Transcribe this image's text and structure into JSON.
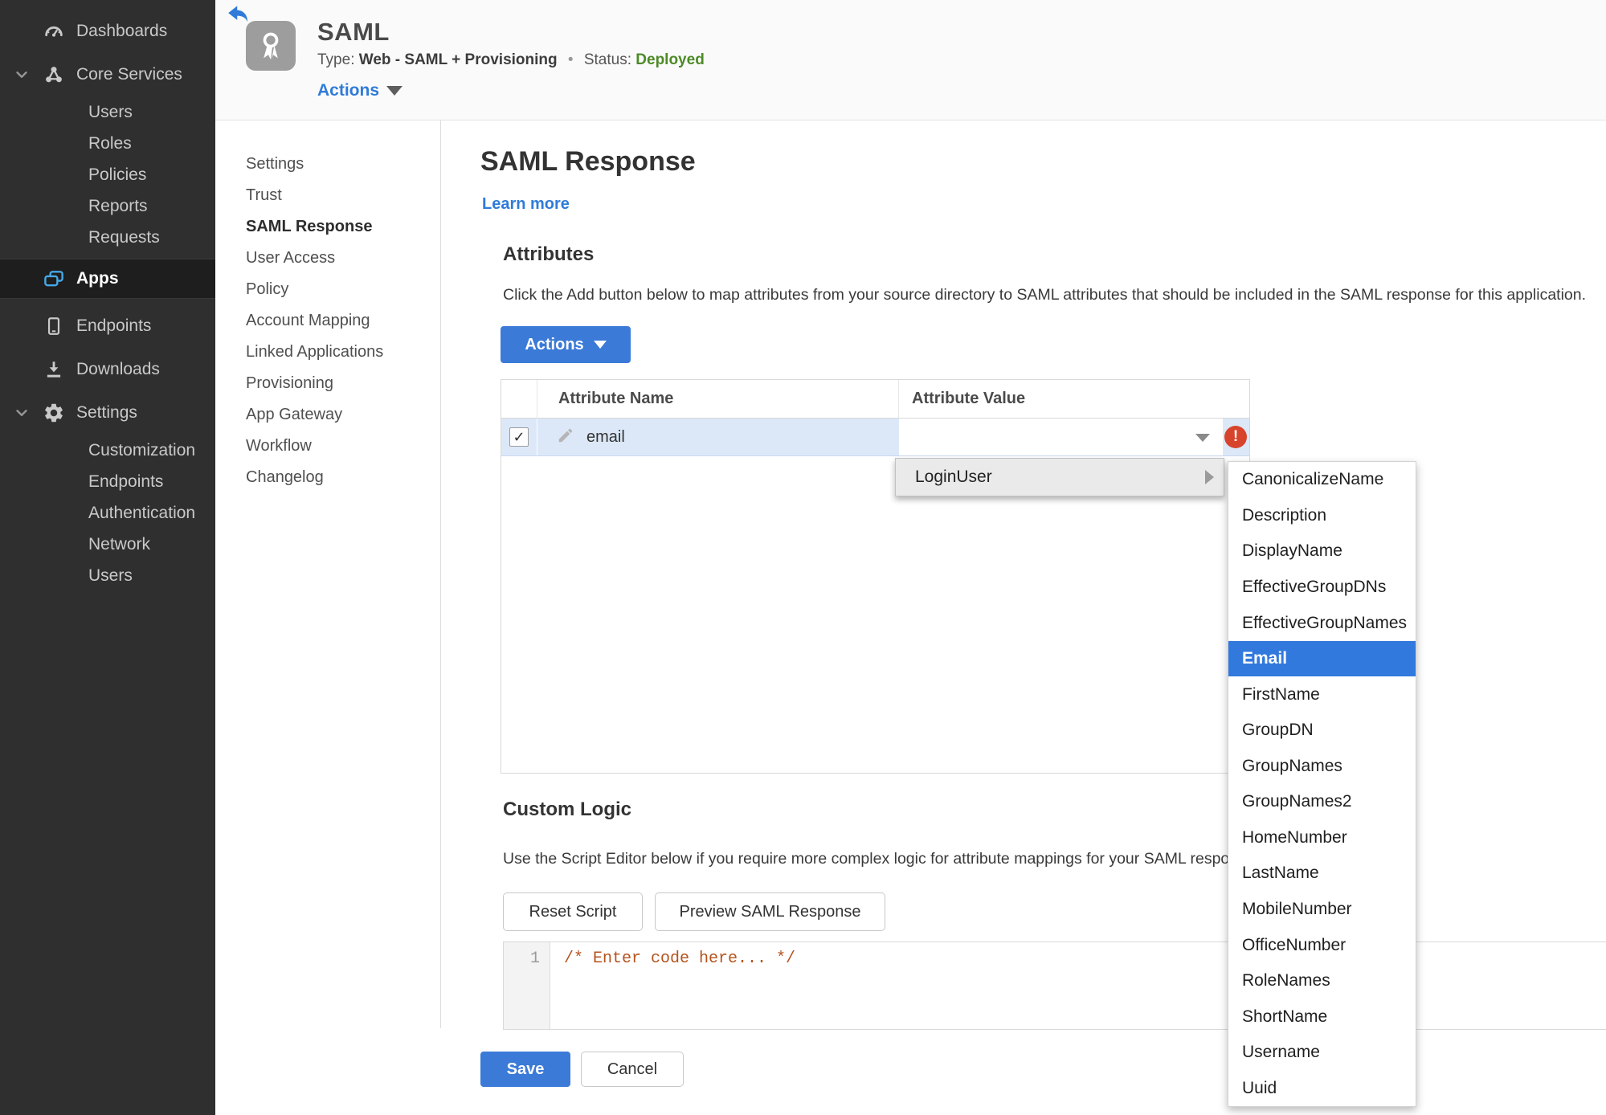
{
  "colors": {
    "accent_blue": "#3b7ad7",
    "link_blue": "#2f7bd9",
    "status_green": "#4d8a27",
    "error_red": "#d8432c",
    "selection_blue": "#3179dd",
    "apps_icon_cyan": "#47a9e8",
    "row_highlight": "#dce8f8",
    "sidebar_bg": "#2f2f2f"
  },
  "sidebar": {
    "items": [
      {
        "label": "Dashboards",
        "icon": "gauge-icon"
      },
      {
        "label": "Core Services",
        "icon": "core-services-icon",
        "chevron": true,
        "expanded": true
      },
      {
        "label": "Users",
        "indent": true
      },
      {
        "label": "Roles",
        "indent": true
      },
      {
        "label": "Policies",
        "indent": true
      },
      {
        "label": "Reports",
        "indent": true
      },
      {
        "label": "Requests",
        "indent": true
      },
      {
        "label": "Apps",
        "icon": "apps-icon",
        "active": true
      },
      {
        "label": "Endpoints",
        "icon": "phone-icon"
      },
      {
        "label": "Downloads",
        "icon": "download-icon"
      },
      {
        "label": "Settings",
        "icon": "gear-icon",
        "chevron": true,
        "expanded": true
      },
      {
        "label": "Customization",
        "indent": true
      },
      {
        "label": "Endpoints",
        "indent": true
      },
      {
        "label": "Authentication",
        "indent": true
      },
      {
        "label": "Network",
        "indent": true
      },
      {
        "label": "Users",
        "indent": true
      }
    ]
  },
  "header": {
    "title": "SAML",
    "type_label": "Type:",
    "type_value": "Web - SAML + Provisioning",
    "separator": "•",
    "status_label": "Status:",
    "status_value": "Deployed",
    "actions_label": "Actions",
    "app_icon": "award-ribbon-icon",
    "back_icon": "back-arrow-icon"
  },
  "subnav": {
    "active": "SAML Response",
    "items": [
      "Settings",
      "Trust",
      "SAML Response",
      "User Access",
      "Policy",
      "Account Mapping",
      "Linked Applications",
      "Provisioning",
      "App Gateway",
      "Workflow",
      "Changelog"
    ]
  },
  "main": {
    "page_title": "SAML Response",
    "learn_more": "Learn more",
    "attributes": {
      "heading": "Attributes",
      "description": "Click the Add button below to map attributes from your source directory to SAML attributes that should be included in the SAML response for this application.",
      "actions_button": "Actions",
      "table": {
        "columns": [
          "Attribute Name",
          "Attribute Value"
        ],
        "rows": [
          {
            "selected": true,
            "name": "email",
            "value": "",
            "has_error": true
          }
        ]
      }
    },
    "value_menu": {
      "item": "LoginUser",
      "has_submenu": true
    },
    "submenu": {
      "selected": "Email",
      "items": [
        "CanonicalizeName",
        "Description",
        "DisplayName",
        "EffectiveGroupDNs",
        "EffectiveGroupNames",
        "Email",
        "FirstName",
        "GroupDN",
        "GroupNames",
        "GroupNames2",
        "HomeNumber",
        "LastName",
        "MobileNumber",
        "OfficeNumber",
        "RoleNames",
        "ShortName",
        "Username",
        "Uuid"
      ]
    },
    "custom_logic": {
      "heading": "Custom Logic",
      "description": "Use the Script Editor below if you require more complex logic for attribute mappings for your SAML response.",
      "reset_button": "Reset Script",
      "preview_button": "Preview SAML Response",
      "editor": {
        "line_number": "1",
        "code": "/* Enter code here... */"
      }
    },
    "save_button": "Save",
    "cancel_button": "Cancel"
  }
}
